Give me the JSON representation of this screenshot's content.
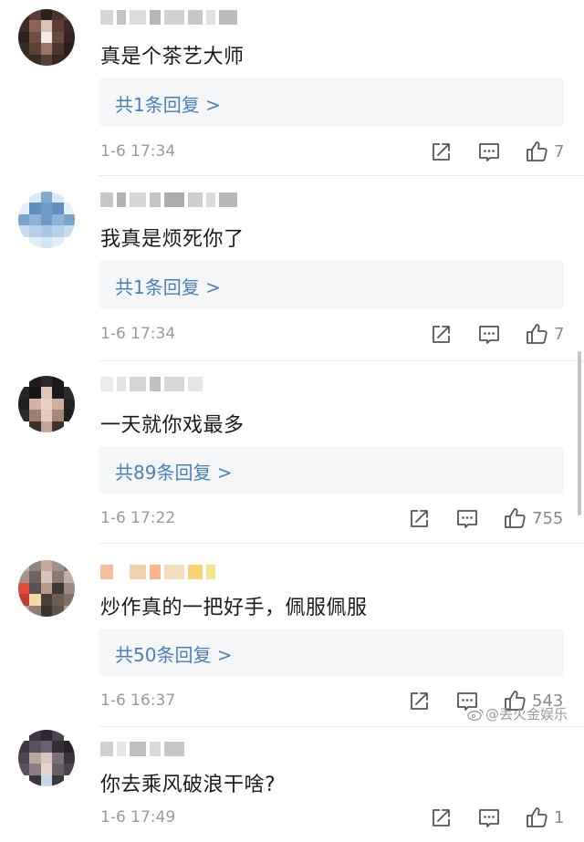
{
  "comments": [
    {
      "text": "真是个茶艺大师",
      "reply_label": "共1条回复 >",
      "date": "1-6 17:34",
      "likes": "7",
      "avatar_colors": [
        "#3a2a28",
        "#5a3d36",
        "#2d1f1c",
        "#4a332d",
        "#6b4b40",
        "#402b26",
        "#8a6555",
        "#d8c3b5",
        "#5c3e34",
        "#3b2824",
        "#2e201d",
        "#704f42",
        "#f3ece6",
        "#6a4a3e",
        "#35241f",
        "#3a2a26",
        "#5b4136",
        "#9a7666",
        "#4d362e",
        "#2b1e1a",
        "#443029",
        "#3b2a25",
        "#57403a",
        "#392822",
        "#2f2220"
      ],
      "name_colors": [
        "#cfcfcf",
        "#b8b8b8",
        "#d6d6d6",
        "#a9a9a9",
        "#c9c9c9",
        "#bdbdbd",
        "#dcdcdc",
        "#b0b0b0"
      ]
    },
    {
      "text": "我真是烦死你了",
      "reply_label": "共1条回复 >",
      "date": "1-6 17:34",
      "likes": "7",
      "avatar_colors": [
        "#ffffff",
        "#d9e8f5",
        "#7fa8cf",
        "#d9e8f5",
        "#ffffff",
        "#e6f0f9",
        "#5f8fbf",
        "#6f9cc9",
        "#5f8fbf",
        "#e6f0f9",
        "#7aa3cc",
        "#8db3d8",
        "#6d9ac6",
        "#8db3d8",
        "#7aa3cc",
        "#c7dcef",
        "#b5d1ea",
        "#a9c8e4",
        "#b5d1ea",
        "#c7dcef",
        "#ffffff",
        "#e2edf7",
        "#d4e5f3",
        "#e2edf7",
        "#ffffff"
      ],
      "name_colors": [
        "#bdbdbd",
        "#a6a6a6",
        "#cfcfcf",
        "#b9b9b9",
        "#9e9e9e",
        "#c4c4c4",
        "#d5d5d5",
        "#ababab"
      ]
    },
    {
      "text": "一天就你戏最多",
      "reply_label": "共89条回复 >",
      "date": "1-6 17:22",
      "likes": "755",
      "avatar_colors": [
        "#ffffff",
        "#1d1d1d",
        "#2a2a2a",
        "#1a1a1a",
        "#ffffff",
        "#262626",
        "#151515",
        "#e0c6b8",
        "#1b1b1b",
        "#2c2c2c",
        "#1f1f1f",
        "#d1b2a3",
        "#e8d1c4",
        "#cfb0a0",
        "#242424",
        "#2a2a2a",
        "#9f7f73",
        "#e4cabd",
        "#a68577",
        "#1e1e1e",
        "#ffffff",
        "#3a2f2c",
        "#c4a59a",
        "#3b302c",
        "#ffffff"
      ],
      "name_colors": [
        "#e8e8e8",
        "#dedede",
        "#cccccc",
        "#b5b5b5",
        "#d0d0d0",
        "#e2e2e2"
      ]
    },
    {
      "text": "炒作真的一把好手，佩服佩服",
      "reply_label": "共50条回复 >",
      "date": "1-6 16:37",
      "likes": "543",
      "avatar_colors": [
        "#b7b3b0",
        "#8d8784",
        "#c8a79a",
        "#9f8f86",
        "#7a6f6b",
        "#a6948b",
        "#6e6461",
        "#d9c5b9",
        "#8a7a72",
        "#c0b1a8",
        "#e04a3a",
        "#5a524f",
        "#b89a8c",
        "#3d3633",
        "#9d8b82",
        "#c43b2f",
        "#f4d9a1",
        "#4a3f3b",
        "#6d5d55",
        "#7f706a",
        "#aaa09b",
        "#8f7f78",
        "#3b3330",
        "#5f524d",
        "#a99890"
      ],
      "name_colors": [
        "#f4b28a",
        "#ffffff",
        "#f0c9a0",
        "#f7a87a",
        "#f3d7b5",
        "#f7ca5a",
        "#f5e07a"
      ]
    },
    {
      "text": "你去乘风破浪干啥?",
      "reply_label": "",
      "date": "1-6 17:49",
      "likes": "1",
      "avatar_colors": [
        "#ffffff",
        "#3a3540",
        "#2e2a33",
        "#4a4450",
        "#ffffff",
        "#3d3842",
        "#5a5160",
        "#6a6070",
        "#322e37",
        "#27232b",
        "#4e4655",
        "#b8a79f",
        "#d6c6bc",
        "#7c6f78",
        "#3a3440",
        "#5c5262",
        "#8d7e86",
        "#e3d3c9",
        "#6a5e66",
        "#4b4450",
        "#ffffff",
        "#3b3540",
        "#c2d8e6",
        "#3b3540",
        "#ffffff"
      ],
      "name_colors": [
        "#c8c8c8",
        "#e3e3e3",
        "#b4b4b4",
        "#d2d2d2",
        "#bdbdbd"
      ]
    }
  ],
  "watermark": "@丢火金娱乐",
  "icons": {
    "share": "share-icon",
    "comment": "comment-icon",
    "like": "thumbs-up-icon",
    "weibo": "weibo-icon"
  },
  "colors": {
    "reply_link": "#4a7fb8",
    "date": "#9a9a9a",
    "reply_bg": "#f5f6f8"
  }
}
